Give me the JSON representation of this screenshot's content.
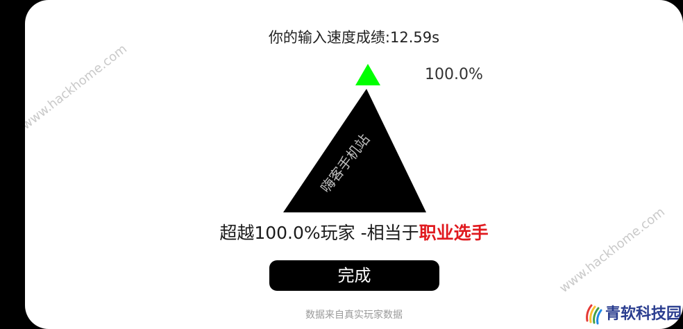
{
  "result_screen": {
    "title": "你的输入速度成绩:12.59s",
    "percent_label": "100.0%",
    "percentile_value": 100.0,
    "result_prefix": "超越100.0%玩家 -相当于",
    "result_rank": "职业选手",
    "done_button_label": "完成",
    "footnote": "数据来自真实玩家数据"
  },
  "watermarks": {
    "site_url_1": "www.hackhome.com",
    "site_url_2": "www.hackhome.com",
    "site_name": "嗨客手机站",
    "brand_name": "青软科技园"
  },
  "colors": {
    "pyramid_fill": "#000000",
    "pyramid_tip": "#00ff00",
    "rank_highlight": "#e0191e",
    "button_bg": "#000000"
  },
  "icons": {
    "pyramid": "pyramid-rank-icon",
    "brand_logo": "qingruan-logo-icon"
  }
}
